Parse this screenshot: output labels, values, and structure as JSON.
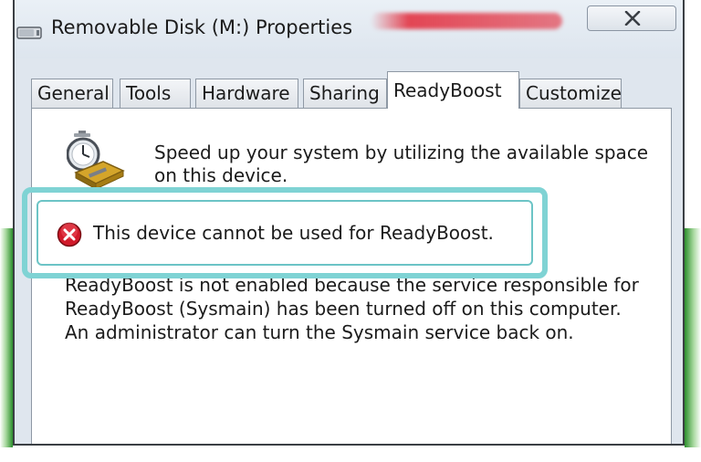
{
  "window": {
    "title": "Removable Disk (M:) Properties"
  },
  "tabs": [
    {
      "label": "General"
    },
    {
      "label": "Tools"
    },
    {
      "label": "Hardware"
    },
    {
      "label": "Sharing"
    },
    {
      "label": "ReadyBoost",
      "active": true
    },
    {
      "label": "Customize"
    }
  ],
  "readyboost": {
    "description": "Speed up your system by utilizing the available space on this device.",
    "error_message": "This device cannot be used for ReadyBoost.",
    "explanation": "ReadyBoost is not enabled because the service responsible for ReadyBoost (Sysmain) has been turned off on this computer. An administrator can turn the Sysmain service back on."
  },
  "colors": {
    "highlight": "#7fd3d4",
    "error_red": "#c8102e",
    "window_bg": "#dfe6ee"
  },
  "icons": {
    "title": "removable-disk-icon",
    "close": "close-icon",
    "readyboost": "stopwatch-drive-icon",
    "error": "error-x-icon"
  }
}
